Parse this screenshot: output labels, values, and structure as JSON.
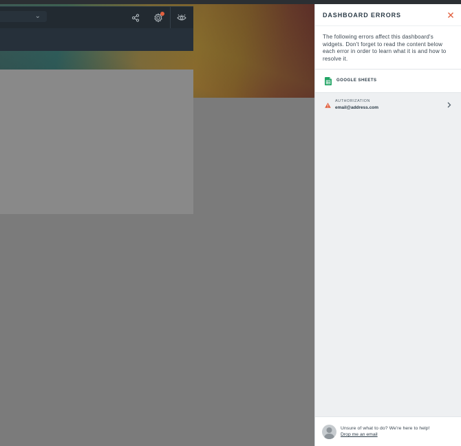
{
  "drawer": {
    "title": "DASHBOARD ERRORS",
    "description": "The following errors affect this dashboard's widgets. Don't forget to read the content below each error in order to learn what it is and how to resolve it.",
    "source": {
      "label": "GOOGLE SHEETS",
      "icon": "google-sheets-icon"
    },
    "errors": [
      {
        "type": "AUTHORIZATION",
        "value": "email@address.com",
        "icon": "warning-icon"
      }
    ],
    "footer": {
      "help_text": "Unsure of what to do? We're here to help!",
      "link_text": "Drop me an email"
    }
  },
  "header": {
    "icons": [
      "share-icon",
      "settings-icon",
      "preview-eye-icon",
      "chevron-down-icon"
    ]
  },
  "colors": {
    "accent_close": "#e2603f",
    "sheets_green": "#23a566",
    "warning": "#e2603f",
    "drawer_bg": "#eef0f2",
    "overlay_gray": "#7b7b7b"
  }
}
